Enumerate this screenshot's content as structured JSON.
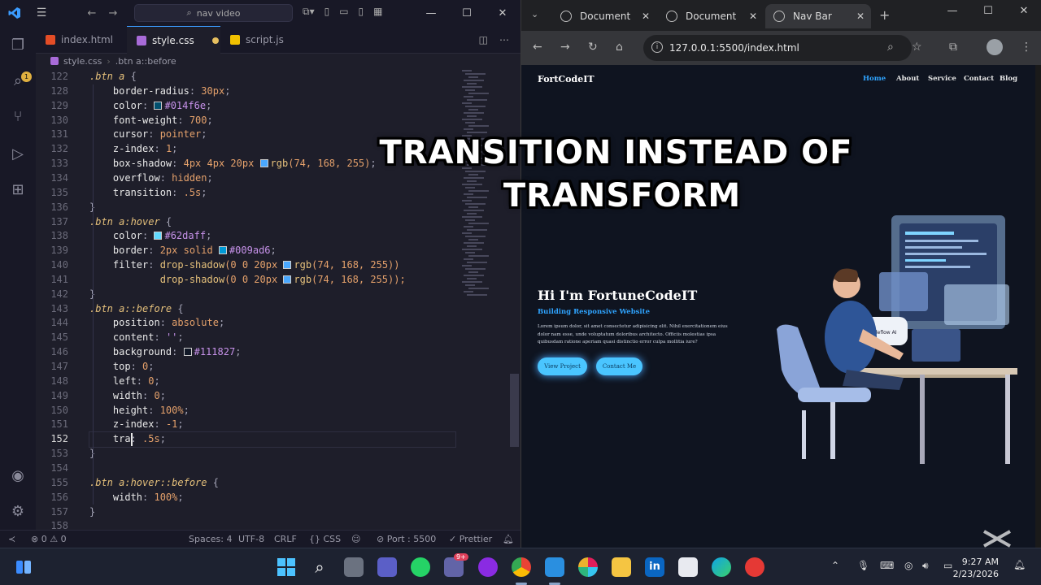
{
  "vscode": {
    "search": "nav video",
    "tabs": [
      {
        "label": "index.html",
        "icon": "html-file-icon",
        "color": "#e44d26"
      },
      {
        "label": "style.css",
        "icon": "css-file-icon",
        "color": "#a86bd8"
      },
      {
        "label": "script.js",
        "icon": "js-file-icon",
        "color": "#f0c000"
      }
    ],
    "breadcrumb": {
      "file": "style.css",
      "symbol": ".btn a::before"
    },
    "activity_badge": "1",
    "lines": [
      {
        "n": "122",
        "segs": [
          {
            "t": ".btn a",
            "c": "sel"
          },
          {
            "t": " {",
            "c": "punc"
          }
        ]
      },
      {
        "n": "128",
        "segs": [
          {
            "t": "    border-radius",
            "c": "prop"
          },
          {
            "t": ": ",
            "c": "punc"
          },
          {
            "t": "30px",
            "c": "num"
          },
          {
            "t": ";",
            "c": "punc"
          }
        ]
      },
      {
        "n": "129",
        "segs": [
          {
            "t": "    color",
            "c": "prop"
          },
          {
            "t": ": ",
            "c": "punc"
          },
          {
            "sw": "#014f6e"
          },
          {
            "t": "#014f6e",
            "c": "str"
          },
          {
            "t": ";",
            "c": "punc"
          }
        ]
      },
      {
        "n": "130",
        "segs": [
          {
            "t": "    font-weight",
            "c": "prop"
          },
          {
            "t": ": ",
            "c": "punc"
          },
          {
            "t": "700",
            "c": "num"
          },
          {
            "t": ";",
            "c": "punc"
          }
        ]
      },
      {
        "n": "131",
        "segs": [
          {
            "t": "    cursor",
            "c": "prop"
          },
          {
            "t": ": ",
            "c": "punc"
          },
          {
            "t": "pointer",
            "c": "kw"
          },
          {
            "t": ";",
            "c": "punc"
          }
        ]
      },
      {
        "n": "132",
        "segs": [
          {
            "t": "    z-index",
            "c": "prop"
          },
          {
            "t": ": ",
            "c": "punc"
          },
          {
            "t": "1",
            "c": "num"
          },
          {
            "t": ";",
            "c": "punc"
          }
        ]
      },
      {
        "n": "133",
        "segs": [
          {
            "t": "    box-shadow",
            "c": "prop"
          },
          {
            "t": ": ",
            "c": "punc"
          },
          {
            "t": "4px 4px 20px ",
            "c": "num"
          },
          {
            "sw": "rgb(74,168,255)"
          },
          {
            "t": "rgb",
            "c": "fn"
          },
          {
            "t": "(74, 168, 255)",
            "c": "num"
          },
          {
            "t": ";",
            "c": "punc"
          }
        ]
      },
      {
        "n": "134",
        "segs": [
          {
            "t": "    overflow",
            "c": "prop"
          },
          {
            "t": ": ",
            "c": "punc"
          },
          {
            "t": "hidden",
            "c": "kw"
          },
          {
            "t": ";",
            "c": "punc"
          }
        ]
      },
      {
        "n": "135",
        "segs": [
          {
            "t": "    transition",
            "c": "prop"
          },
          {
            "t": ": ",
            "c": "punc"
          },
          {
            "t": ".5s",
            "c": "num"
          },
          {
            "t": ";",
            "c": "punc"
          }
        ]
      },
      {
        "n": "136",
        "segs": [
          {
            "t": "}",
            "c": "punc"
          }
        ]
      },
      {
        "n": "137",
        "segs": [
          {
            "t": ".btn a:hover",
            "c": "sel"
          },
          {
            "t": " {",
            "c": "punc"
          }
        ]
      },
      {
        "n": "138",
        "segs": [
          {
            "t": "    color",
            "c": "prop"
          },
          {
            "t": ": ",
            "c": "punc"
          },
          {
            "sw": "#62daff"
          },
          {
            "t": "#62daff",
            "c": "str"
          },
          {
            "t": ";",
            "c": "punc"
          }
        ]
      },
      {
        "n": "139",
        "segs": [
          {
            "t": "    border",
            "c": "prop"
          },
          {
            "t": ": ",
            "c": "punc"
          },
          {
            "t": "2px solid ",
            "c": "num"
          },
          {
            "sw": "#009ad6"
          },
          {
            "t": "#009ad6",
            "c": "str"
          },
          {
            "t": ";",
            "c": "punc"
          }
        ]
      },
      {
        "n": "140",
        "segs": [
          {
            "t": "    filter",
            "c": "prop"
          },
          {
            "t": ": ",
            "c": "punc"
          },
          {
            "t": "drop-shadow",
            "c": "fn"
          },
          {
            "t": "(0 0 20px ",
            "c": "num"
          },
          {
            "sw": "rgb(74,168,255)"
          },
          {
            "t": "rgb",
            "c": "fn"
          },
          {
            "t": "(74, 168, 255))",
            "c": "num"
          }
        ]
      },
      {
        "n": "141",
        "segs": [
          {
            "t": "            drop-shadow",
            "c": "fn"
          },
          {
            "t": "(0 0 20px ",
            "c": "num"
          },
          {
            "sw": "rgb(74,168,255)"
          },
          {
            "t": "rgb",
            "c": "fn"
          },
          {
            "t": "(74, 168, 255));",
            "c": "num"
          }
        ]
      },
      {
        "n": "142",
        "segs": [
          {
            "t": "}",
            "c": "punc"
          }
        ]
      },
      {
        "n": "143",
        "segs": [
          {
            "t": ".btn a::before",
            "c": "sel"
          },
          {
            "t": " {",
            "c": "punc"
          }
        ]
      },
      {
        "n": "144",
        "segs": [
          {
            "t": "    position",
            "c": "prop"
          },
          {
            "t": ": ",
            "c": "punc"
          },
          {
            "t": "absolute",
            "c": "kw"
          },
          {
            "t": ";",
            "c": "punc"
          }
        ]
      },
      {
        "n": "145",
        "segs": [
          {
            "t": "    content",
            "c": "prop"
          },
          {
            "t": ": ",
            "c": "punc"
          },
          {
            "t": "''",
            "c": "str"
          },
          {
            "t": ";",
            "c": "punc"
          }
        ]
      },
      {
        "n": "146",
        "segs": [
          {
            "t": "    background",
            "c": "prop"
          },
          {
            "t": ": ",
            "c": "punc"
          },
          {
            "sw": "#111827"
          },
          {
            "t": "#111827",
            "c": "str"
          },
          {
            "t": ";",
            "c": "punc"
          }
        ]
      },
      {
        "n": "147",
        "segs": [
          {
            "t": "    top",
            "c": "prop"
          },
          {
            "t": ": ",
            "c": "punc"
          },
          {
            "t": "0",
            "c": "num"
          },
          {
            "t": ";",
            "c": "punc"
          }
        ]
      },
      {
        "n": "148",
        "segs": [
          {
            "t": "    left",
            "c": "prop"
          },
          {
            "t": ": ",
            "c": "punc"
          },
          {
            "t": "0",
            "c": "num"
          },
          {
            "t": ";",
            "c": "punc"
          }
        ]
      },
      {
        "n": "149",
        "segs": [
          {
            "t": "    width",
            "c": "prop"
          },
          {
            "t": ": ",
            "c": "punc"
          },
          {
            "t": "0",
            "c": "num"
          },
          {
            "t": ";",
            "c": "punc"
          }
        ]
      },
      {
        "n": "150",
        "segs": [
          {
            "t": "    height",
            "c": "prop"
          },
          {
            "t": ": ",
            "c": "punc"
          },
          {
            "t": "100%",
            "c": "num"
          },
          {
            "t": ";",
            "c": "punc"
          }
        ]
      },
      {
        "n": "151",
        "segs": [
          {
            "t": "    z-index",
            "c": "prop"
          },
          {
            "t": ": ",
            "c": "punc"
          },
          {
            "t": "-1",
            "c": "num"
          },
          {
            "t": ";",
            "c": "punc"
          }
        ]
      },
      {
        "n": "152",
        "current": true,
        "segs": [
          {
            "t": "    tra",
            "c": "prop"
          },
          {
            "t": ": ",
            "c": "punc"
          },
          {
            "t": ".5s",
            "c": "num"
          },
          {
            "t": ";",
            "c": "punc"
          }
        ]
      },
      {
        "n": "153",
        "segs": [
          {
            "t": "}",
            "c": "punc"
          }
        ]
      },
      {
        "n": "154",
        "segs": []
      },
      {
        "n": "155",
        "segs": [
          {
            "t": ".btn a:hover::before",
            "c": "sel"
          },
          {
            "t": " {",
            "c": "punc"
          }
        ]
      },
      {
        "n": "156",
        "segs": [
          {
            "t": "    width",
            "c": "prop"
          },
          {
            "t": ": ",
            "c": "punc"
          },
          {
            "t": "100%",
            "c": "num"
          },
          {
            "t": ";",
            "c": "punc"
          }
        ]
      },
      {
        "n": "157",
        "segs": [
          {
            "t": "}",
            "c": "punc"
          }
        ]
      },
      {
        "n": "158",
        "segs": []
      }
    ],
    "status": {
      "problems": "0",
      "warnings": "0",
      "spaces": "Spaces: 4",
      "encoding": "UTF-8",
      "eol": "CRLF",
      "lang": "CSS",
      "port": "Port : 5500",
      "prettier": "Prettier"
    }
  },
  "browser": {
    "tabs": [
      "Document",
      "Document",
      "Nav Bar"
    ],
    "url": "127.0.0.1:5500/index.html",
    "page": {
      "logo": "FortCodeIT",
      "nav": [
        "Home",
        "About",
        "Service",
        "Contact",
        "Blog"
      ],
      "heading": "Hi I'm FortuneCodeIT",
      "subheading": "Building Responsive Website",
      "paragraph": "Lorem ipsum dolor, sit amet consectetur adipisicing elit. Nihil exercitationem eius dolor nam esse, unde voluptatum doloribus architecto. Officiis molestias ipsa quibusdam ratione aperiam quasi distinctio error culpa mollitia iure?",
      "buttons": [
        "View Project",
        "Contact Me"
      ],
      "illustration_label": "Codeflow AI"
    }
  },
  "overlay": {
    "line1": "TRANSITION INSTEAD OF",
    "line2": "TRANSFORM"
  },
  "taskbar": {
    "time": "9:27 AM",
    "date": "2/23/2026",
    "teams_badge": "9+"
  }
}
